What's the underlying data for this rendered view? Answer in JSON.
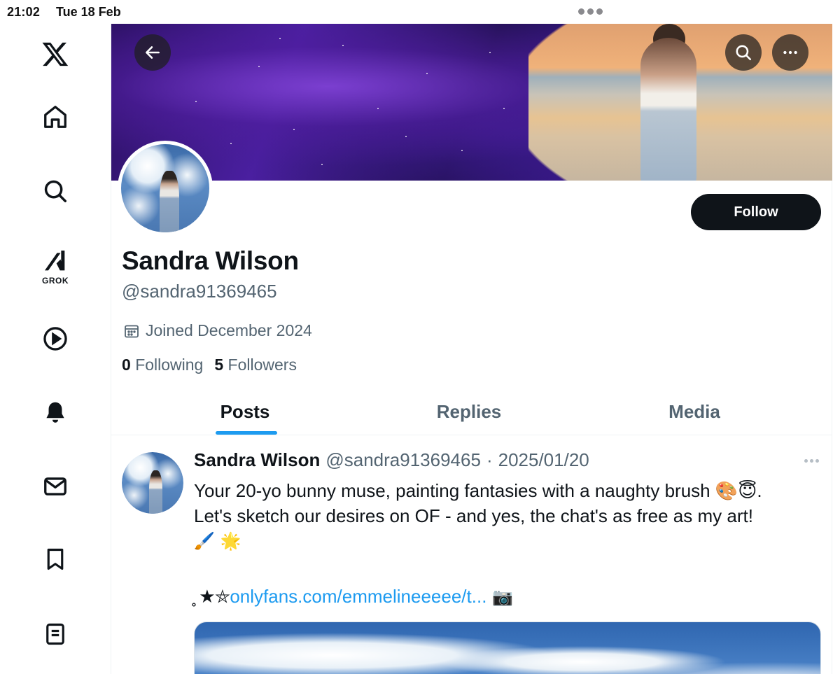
{
  "status_bar": {
    "time": "21:02",
    "date": "Tue 18 Feb"
  },
  "sidebar": {
    "items": [
      {
        "name": "x-logo",
        "label": ""
      },
      {
        "name": "home",
        "label": ""
      },
      {
        "name": "explore",
        "label": ""
      },
      {
        "name": "grok",
        "label": "GROK"
      },
      {
        "name": "videos",
        "label": ""
      },
      {
        "name": "notifications",
        "label": ""
      },
      {
        "name": "messages",
        "label": ""
      },
      {
        "name": "bookmarks",
        "label": ""
      },
      {
        "name": "lists",
        "label": ""
      }
    ]
  },
  "profile": {
    "name": "Sandra Wilson",
    "handle": "@sandra91369465",
    "joined": "Joined December 2024",
    "following_count": "0",
    "following_label": "Following",
    "followers_count": "5",
    "followers_label": "Followers",
    "follow_button": "Follow"
  },
  "tabs": [
    {
      "label": "Posts",
      "active": true
    },
    {
      "label": "Replies",
      "active": false
    },
    {
      "label": "Media",
      "active": false
    }
  ],
  "post": {
    "name": "Sandra Wilson",
    "handle": "@sandra91369465",
    "separator": "·",
    "date": "2025/01/20",
    "text_line1": "Your 20-yo bunny muse, painting fantasies with a naughty brush 🎨😇.",
    "text_line2": "Let's sketch our desires on OF - and yes, the chat's as free as my art!",
    "text_line3": "🖌️ 🌟",
    "link_prefix": "̥̥ ★⛤",
    "link_text": "onlyfans.com/emmelineeeee/t...",
    "link_suffix": " 📷"
  },
  "colors": {
    "accent": "#1d9bf0",
    "text_primary": "#0f1419",
    "text_secondary": "#536471",
    "follow_bg": "#0f1419"
  }
}
